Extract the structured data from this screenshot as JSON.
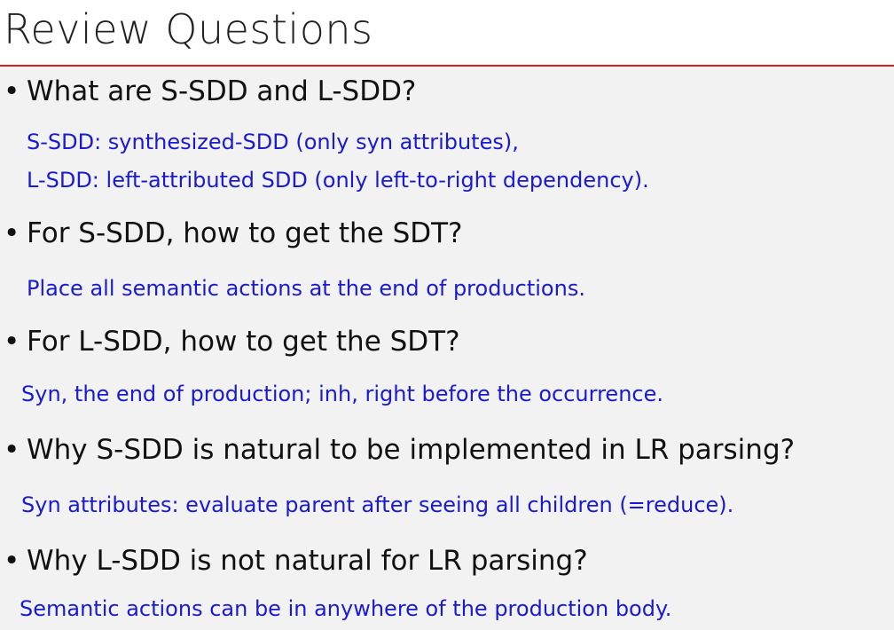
{
  "title": "Review Questions",
  "bullet": "•",
  "questions": [
    {
      "question": "What are S-SDD and L-SDD?",
      "answers": [
        "S-SDD: synthesized-SDD (only syn attributes),",
        "L-SDD: left-attributed SDD (only left-to-right dependency)."
      ]
    },
    {
      "question": "For S-SDD, how to get the SDT?",
      "answers": [
        "Place all semantic actions at the end of productions."
      ]
    },
    {
      "question": "For L-SDD, how to get the SDT?",
      "answers": [
        "Syn, the end of production; inh, right before the occurrence."
      ]
    },
    {
      "question": "Why S-SDD is natural to be implemented in LR parsing?",
      "answers": [
        "Syn attributes: evaluate parent after seeing all children (=reduce)."
      ]
    },
    {
      "question": "Why L-SDD is not natural for LR parsing?",
      "answers": [
        "Semantic actions can be in anywhere of the production body."
      ]
    }
  ]
}
